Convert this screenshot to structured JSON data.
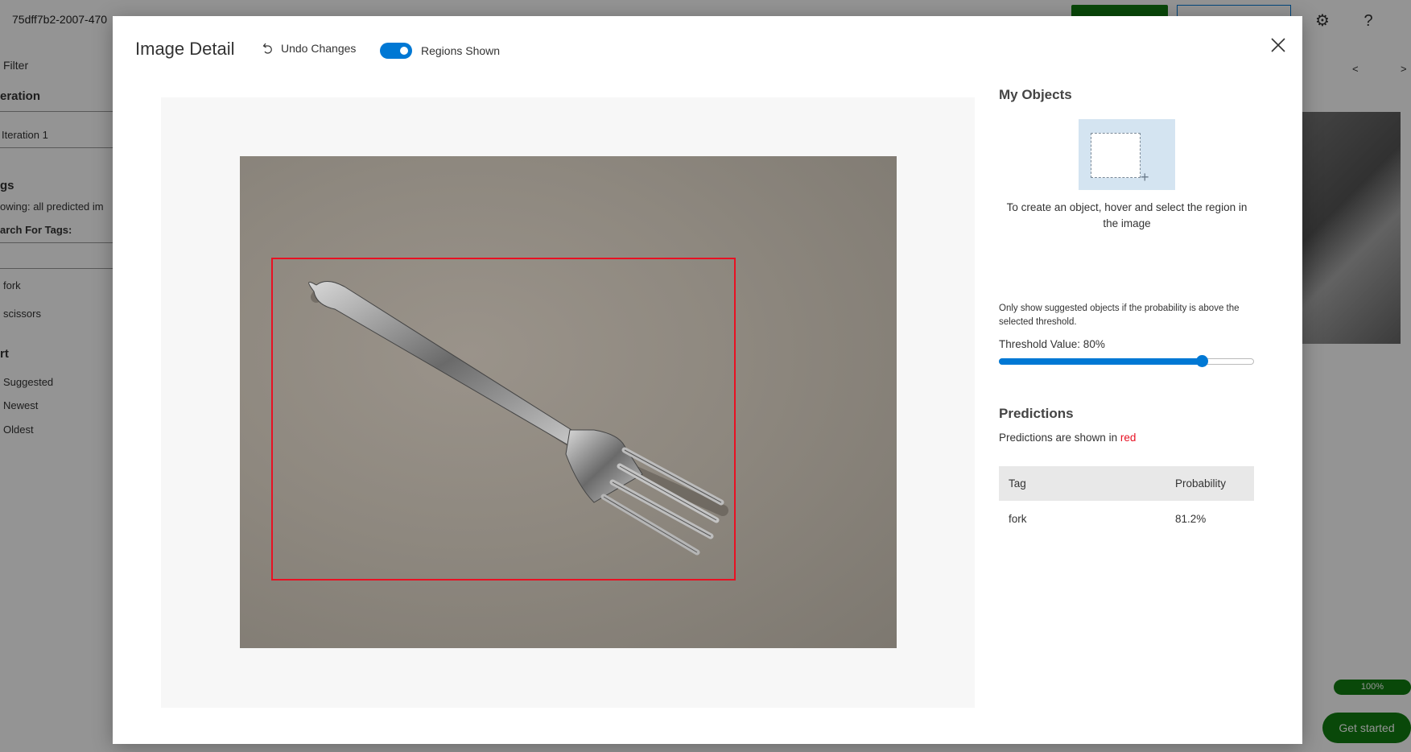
{
  "background": {
    "project_id": "75dff7b2-2007-470",
    "sidebar": {
      "filter_label": "Filter",
      "iteration_heading": "eration",
      "iteration_value": "Iteration 1",
      "tags_heading": "gs",
      "showing_text": "owing: all predicted im",
      "search_label": "arch For Tags:",
      "tag_items": [
        "fork",
        "scissors"
      ],
      "sort_heading": "rt",
      "sort_items": [
        "Suggested",
        "Newest",
        "Oldest"
      ]
    },
    "progress_label": "100%",
    "get_started_label": "Get started",
    "nav_prev": "<",
    "nav_next": ">"
  },
  "modal": {
    "title": "Image Detail",
    "undo_label": "Undo Changes",
    "toggle_label": "Regions Shown",
    "toggle_on": true
  },
  "image": {
    "region_color": "#e81123"
  },
  "right_panel": {
    "my_objects_title": "My Objects",
    "create_hint": "To create an object, hover and select the region in the image",
    "threshold_note": "Only show suggested objects if the probability is above the selected threshold.",
    "threshold_label": "Threshold Value: 80%",
    "threshold_value": 0.8,
    "predictions_title": "Predictions",
    "predictions_note_prefix": "Predictions are shown in",
    "predictions_note_color_word": "red",
    "table": {
      "headers": [
        "Tag",
        "Probability"
      ],
      "rows": [
        {
          "tag": "fork",
          "probability": "81.2%"
        }
      ]
    }
  },
  "colors": {
    "accent": "#0078d4",
    "prediction_red": "#e81123",
    "brand_green": "#107c10"
  }
}
